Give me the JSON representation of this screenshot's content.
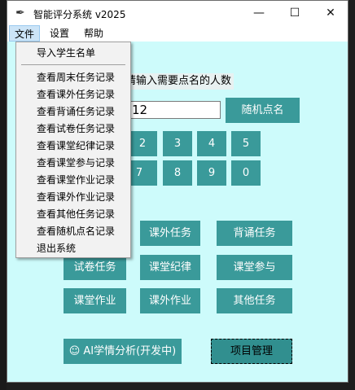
{
  "window": {
    "title": "智能评分系统 v2025",
    "feather_icon": "✒",
    "min_glyph": "—",
    "max_glyph": "☐",
    "close_glyph": "✕"
  },
  "menubar": {
    "file": "文件",
    "settings": "设置",
    "help": "帮助"
  },
  "file_menu": [
    "导入学生名单",
    "查看周末任务记录",
    "查看课外任务记录",
    "查看背诵任务记录",
    "查看试卷任务记录",
    "查看课堂纪律记录",
    "查看课堂参与记录",
    "查看课堂作业记录",
    "查看课外作业记录",
    "查看其他任务记录",
    "查看随机点名记录",
    "退出系统"
  ],
  "roll_call": {
    "prompt": "请输入需要点名的人数",
    "count_value": "12",
    "random_button": "随机点名"
  },
  "keypad": [
    "2",
    "3",
    "4",
    "5",
    "7",
    "8",
    "9",
    "0"
  ],
  "tasks": {
    "extracurricular": "课外任务",
    "recitation": "背诵任务",
    "exam": "试卷任务",
    "discipline": "课堂纪律",
    "participation": "课堂参与",
    "classwork": "课堂作业",
    "homework": "课外作业",
    "other": "其他任务"
  },
  "bottom": {
    "ai_icon": "☺",
    "ai_analysis": "AI学情分析(开发中)",
    "project_mgmt": "项目管理"
  },
  "colors": {
    "window_bg": "#cdfbfb",
    "button_bg": "#3a9a9a",
    "button_text": "#ffffff"
  }
}
